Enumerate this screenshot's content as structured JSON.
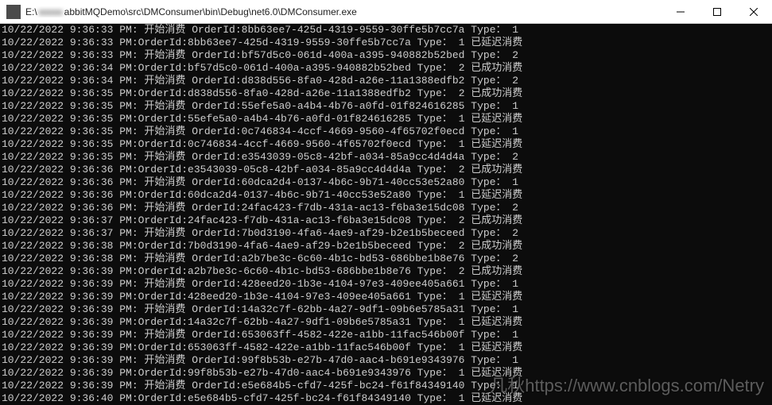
{
  "window": {
    "path_prefix": "E:\\",
    "path_blur1": "xxxxx",
    "path_mid": "abbitMQDemo\\src\\DMConsumer\\bin\\Debug\\net6.0\\DMConsumer.exe"
  },
  "watermark": {
    "name": "凡秋",
    "url": "https://www.cnblogs.com/Netry"
  },
  "labels": {
    "start_consume": "开始消费",
    "success_consume": "已成功消费",
    "delay_consume": "已延迟消费"
  },
  "log": [
    {
      "ts": "10/22/2022 9:36:33 PM",
      "kind": "start",
      "orderId": "8bb63ee7-425d-4319-9559-30ffe5b7cc7a",
      "type": "1"
    },
    {
      "ts": "10/22/2022 9:36:33 PM",
      "kind": "delay",
      "orderId": "8bb63ee7-425d-4319-9559-30ffe5b7cc7a",
      "type": "1"
    },
    {
      "ts": "10/22/2022 9:36:33 PM",
      "kind": "start",
      "orderId": "bf57d5c0-061d-400a-a395-940882b52bed",
      "type": "2"
    },
    {
      "ts": "10/22/2022 9:36:34 PM",
      "kind": "success",
      "orderId": "bf57d5c0-061d-400a-a395-940882b52bed",
      "type": "2"
    },
    {
      "ts": "10/22/2022 9:36:34 PM",
      "kind": "start",
      "orderId": "d838d556-8fa0-428d-a26e-11a1388edfb2",
      "type": "2"
    },
    {
      "ts": "10/22/2022 9:36:35 PM",
      "kind": "success",
      "orderId": "d838d556-8fa0-428d-a26e-11a1388edfb2",
      "type": "2"
    },
    {
      "ts": "10/22/2022 9:36:35 PM",
      "kind": "start",
      "orderId": "55efe5a0-a4b4-4b76-a0fd-01f824616285",
      "type": "1"
    },
    {
      "ts": "10/22/2022 9:36:35 PM",
      "kind": "delay",
      "orderId": "55efe5a0-a4b4-4b76-a0fd-01f824616285",
      "type": "1"
    },
    {
      "ts": "10/22/2022 9:36:35 PM",
      "kind": "start",
      "orderId": "0c746834-4ccf-4669-9560-4f65702f0ecd",
      "type": "1"
    },
    {
      "ts": "10/22/2022 9:36:35 PM",
      "kind": "delay",
      "orderId": "0c746834-4ccf-4669-9560-4f65702f0ecd",
      "type": "1"
    },
    {
      "ts": "10/22/2022 9:36:35 PM",
      "kind": "start",
      "orderId": "e3543039-05c8-42bf-a034-85a9cc4d4d4a",
      "type": "2"
    },
    {
      "ts": "10/22/2022 9:36:36 PM",
      "kind": "success",
      "orderId": "e3543039-05c8-42bf-a034-85a9cc4d4d4a",
      "type": "2"
    },
    {
      "ts": "10/22/2022 9:36:36 PM",
      "kind": "start",
      "orderId": "60dca2d4-0137-4b6c-9b71-40cc53e52a80",
      "type": "1"
    },
    {
      "ts": "10/22/2022 9:36:36 PM",
      "kind": "delay",
      "orderId": "60dca2d4-0137-4b6c-9b71-40cc53e52a80",
      "type": "1"
    },
    {
      "ts": "10/22/2022 9:36:36 PM",
      "kind": "start",
      "orderId": "24fac423-f7db-431a-ac13-f6ba3e15dc08",
      "type": "2"
    },
    {
      "ts": "10/22/2022 9:36:37 PM",
      "kind": "success",
      "orderId": "24fac423-f7db-431a-ac13-f6ba3e15dc08",
      "type": "2"
    },
    {
      "ts": "10/22/2022 9:36:37 PM",
      "kind": "start",
      "orderId": "7b0d3190-4fa6-4ae9-af29-b2e1b5beceed",
      "type": "2"
    },
    {
      "ts": "10/22/2022 9:36:38 PM",
      "kind": "success",
      "orderId": "7b0d3190-4fa6-4ae9-af29-b2e1b5beceed",
      "type": "2"
    },
    {
      "ts": "10/22/2022 9:36:38 PM",
      "kind": "start",
      "orderId": "a2b7be3c-6c60-4b1c-bd53-686bbe1b8e76",
      "type": "2"
    },
    {
      "ts": "10/22/2022 9:36:39 PM",
      "kind": "success",
      "orderId": "a2b7be3c-6c60-4b1c-bd53-686bbe1b8e76",
      "type": "2"
    },
    {
      "ts": "10/22/2022 9:36:39 PM",
      "kind": "start",
      "orderId": "428eed20-1b3e-4104-97e3-409ee405a661",
      "type": "1"
    },
    {
      "ts": "10/22/2022 9:36:39 PM",
      "kind": "delay",
      "orderId": "428eed20-1b3e-4104-97e3-409ee405a661",
      "type": "1"
    },
    {
      "ts": "10/22/2022 9:36:39 PM",
      "kind": "start",
      "orderId": "14a32c7f-62bb-4a27-9df1-09b6e5785a31",
      "type": "1"
    },
    {
      "ts": "10/22/2022 9:36:39 PM",
      "kind": "delay",
      "orderId": "14a32c7f-62bb-4a27-9df1-09b6e5785a31",
      "type": "1"
    },
    {
      "ts": "10/22/2022 9:36:39 PM",
      "kind": "start",
      "orderId": "653063ff-4582-422e-a1bb-11fac546b00f",
      "type": "1"
    },
    {
      "ts": "10/22/2022 9:36:39 PM",
      "kind": "delay",
      "orderId": "653063ff-4582-422e-a1bb-11fac546b00f",
      "type": "1"
    },
    {
      "ts": "10/22/2022 9:36:39 PM",
      "kind": "start",
      "orderId": "99f8b53b-e27b-47d0-aac4-b691e9343976",
      "type": "1"
    },
    {
      "ts": "10/22/2022 9:36:39 PM",
      "kind": "delay",
      "orderId": "99f8b53b-e27b-47d0-aac4-b691e9343976",
      "type": "1"
    },
    {
      "ts": "10/22/2022 9:36:39 PM",
      "kind": "start",
      "orderId": "e5e684b5-cfd7-425f-bc24-f61f84349140",
      "type": "1"
    },
    {
      "ts": "10/22/2022 9:36:40 PM",
      "kind": "delay",
      "orderId": "e5e684b5-cfd7-425f-bc24-f61f84349140",
      "type": "1"
    }
  ]
}
